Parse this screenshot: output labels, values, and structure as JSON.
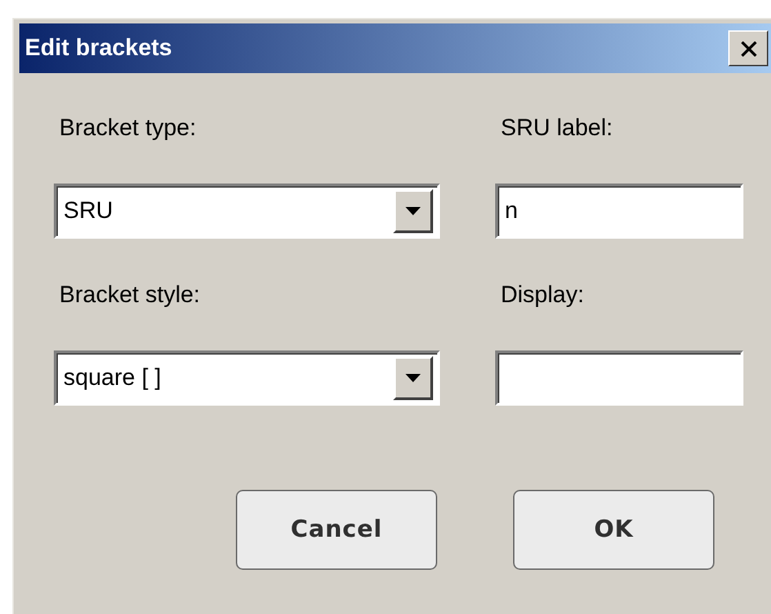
{
  "window": {
    "title": "Edit brackets"
  },
  "fields": [
    {
      "kind": "combo",
      "label": "Bracket type:",
      "value": "SRU"
    },
    {
      "kind": "text",
      "label": "SRU label:",
      "value": "n"
    },
    {
      "kind": "combo",
      "label": "Bracket style:",
      "value": "square [ ]"
    },
    {
      "kind": "text",
      "label": "Display:"
    }
  ],
  "buttons": [
    "Cancel",
    "OK"
  ]
}
